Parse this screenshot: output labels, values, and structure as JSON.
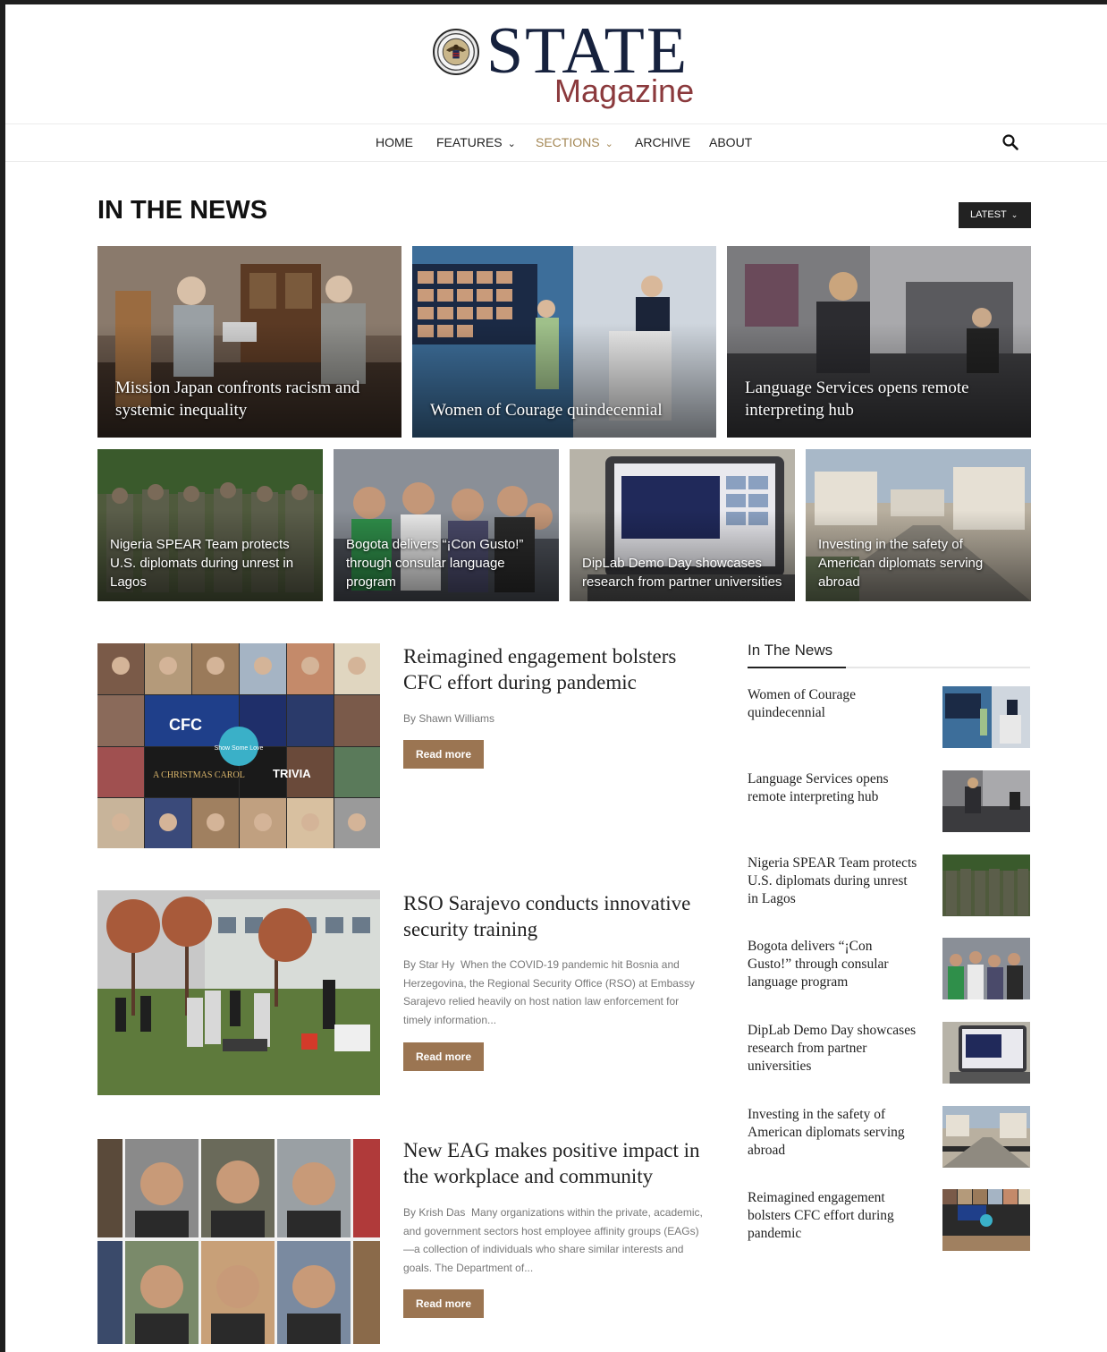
{
  "masthead": {
    "title": "STATE",
    "subtitle": "Magazine"
  },
  "nav": {
    "items": [
      {
        "label": "HOME"
      },
      {
        "label": "FEATURES"
      },
      {
        "label": "SECTIONS"
      },
      {
        "label": "ARCHIVE"
      },
      {
        "label": "ABOUT"
      }
    ]
  },
  "section": {
    "title": "IN THE NEWS",
    "sort_label": "LATEST"
  },
  "featured_large": [
    {
      "caption": "Mission Japan confronts racism and systemic inequality"
    },
    {
      "caption": "Women of Courage quindecennial"
    },
    {
      "caption": "Language Services opens remote interpreting hub"
    }
  ],
  "featured_small": [
    {
      "caption": "Nigeria SPEAR Team protects U.S. diplomats during unrest in Lagos"
    },
    {
      "caption": "Bogota delivers “¡Con Gusto!” through consular language program"
    },
    {
      "caption": "DipLab Demo Day showcases research from partner universities"
    },
    {
      "caption": "Investing in the safety of American diplomats serving abroad"
    }
  ],
  "articles": [
    {
      "title": "Reimagined engagement bolsters CFC effort during pandemic",
      "author": "By Shawn Williams",
      "excerpt": "",
      "image_text": {
        "cfc": "CFC",
        "love": "Show Some Love",
        "carol": "A CHRISTMAS CAROL",
        "trivia": "TRIVIA"
      },
      "read_more": "Read more"
    },
    {
      "title": "RSO Sarajevo conducts innovative security training",
      "author": "By Star Hy",
      "excerpt": "When the COVID-19 pandemic hit Bosnia and Herzegovina, the Regional Security Office (RSO) at Embassy Sarajevo relied heavily on host nation law enforcement for timely information...",
      "read_more": "Read more"
    },
    {
      "title": "New EAG makes positive impact in the workplace and community",
      "author": "By Krish Das",
      "excerpt": "Many organizations within the private, academic, and government sectors host employee affinity groups (EAGs)—a collection of individuals who share similar interests and goals. The Department of...",
      "read_more": "Read more"
    }
  ],
  "sidebar": {
    "title": "In The News",
    "items": [
      {
        "title": "Women of Courage quindecennial"
      },
      {
        "title": "Language Services opens remote interpreting hub"
      },
      {
        "title": "Nigeria SPEAR Team protects U.S. diplomats during unrest in Lagos"
      },
      {
        "title": "Bogota delivers “¡Con Gusto!” through consular language program"
      },
      {
        "title": "DipLab Demo Day showcases research from partner universities"
      },
      {
        "title": "Investing in the safety of American diplomats serving abroad"
      },
      {
        "title": "Reimagined engagement bolsters CFC effort during pandemic"
      }
    ]
  },
  "colors": {
    "brand_navy": "#16213d",
    "brand_maroon": "#8b3a3d",
    "accent_gold": "#a48754",
    "button_brown": "#9b7552"
  }
}
